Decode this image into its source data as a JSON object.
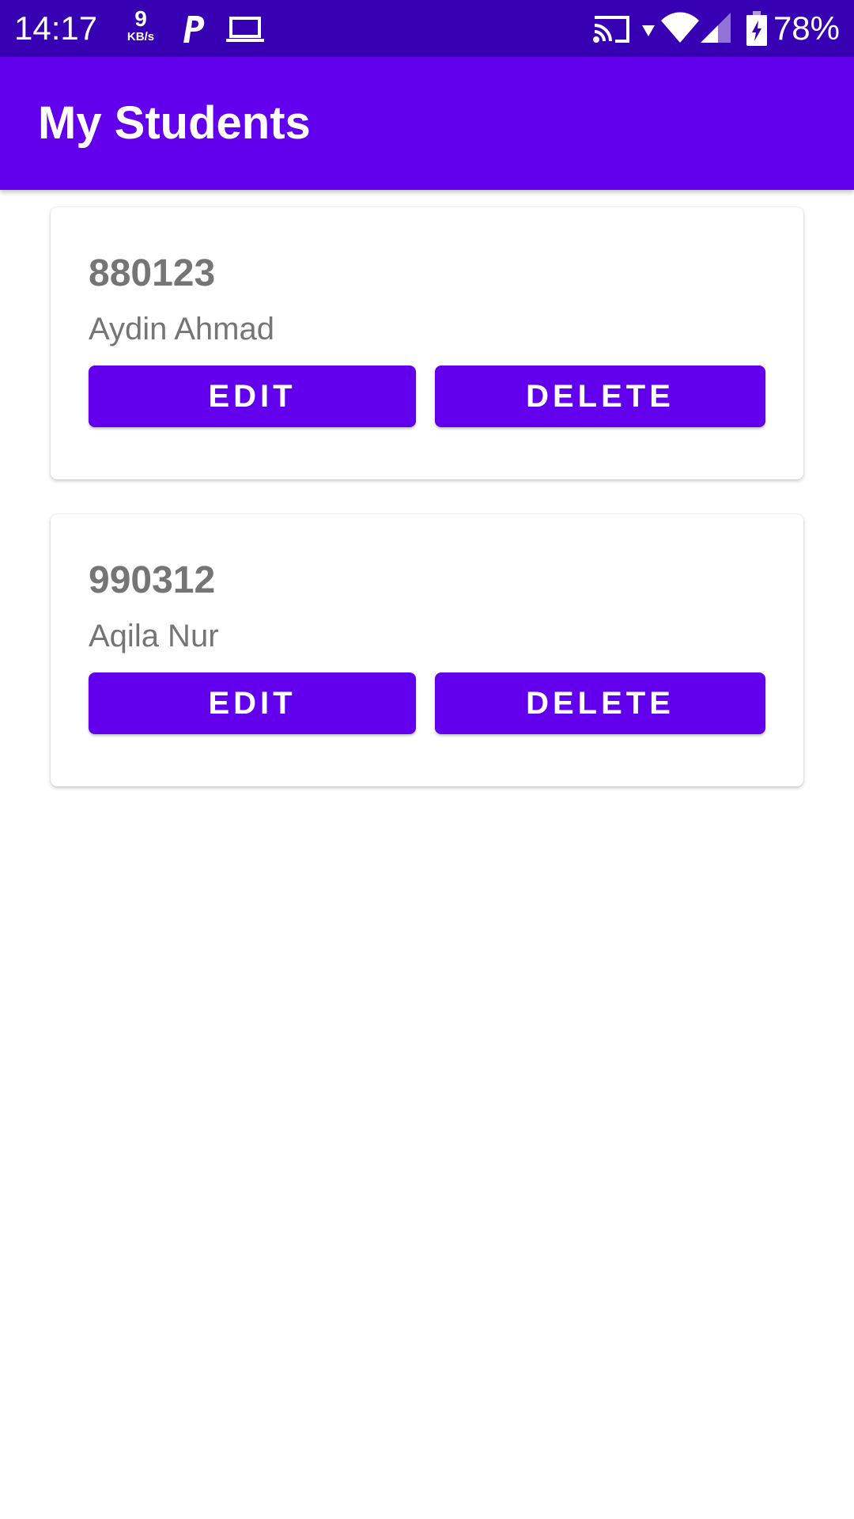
{
  "status_bar": {
    "time": "14:17",
    "net_speed_value": "9",
    "net_speed_unit": "KB/s",
    "battery_percent": "78%",
    "icons": [
      "parking-icon",
      "laptop-icon",
      "cast-icon",
      "wifi-icon",
      "signal-icon",
      "battery-charging-icon"
    ]
  },
  "app_bar": {
    "title": "My Students"
  },
  "students": [
    {
      "id": "880123",
      "name": "Aydin Ahmad",
      "edit_label": "EDIT",
      "delete_label": "DELETE"
    },
    {
      "id": "990312",
      "name": "Aqila Nur",
      "edit_label": "EDIT",
      "delete_label": "DELETE"
    }
  ],
  "colors": {
    "status_bar": "#3700b3",
    "primary": "#6200ee",
    "card_text": "#757575"
  }
}
